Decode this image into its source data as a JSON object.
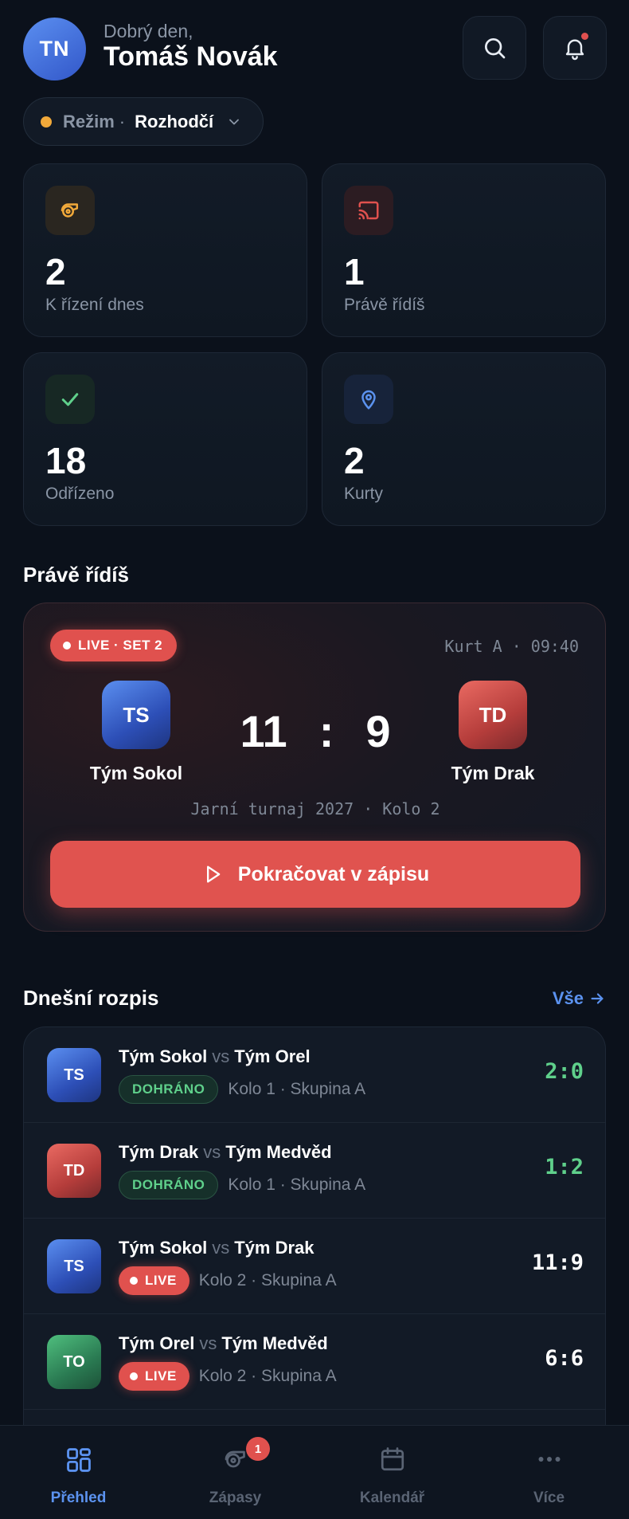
{
  "header": {
    "avatar_initials": "TN",
    "greeting": "Dobrý den,",
    "user_name": "Tomáš Novák",
    "search_icon": "search-icon",
    "bell_icon": "bell-icon"
  },
  "mode": {
    "label": "Režim",
    "separator": "·",
    "value": "Rozhodčí",
    "dot_color": "#f1a93a"
  },
  "stats": [
    {
      "value": "2",
      "label": "K řízení dnes",
      "icon": "whistle-icon",
      "color": "#f1a93a"
    },
    {
      "value": "1",
      "label": "Právě řídíš",
      "icon": "cast-icon",
      "color": "#e0514e"
    },
    {
      "value": "18",
      "label": "Odřízeno",
      "icon": "check-icon",
      "color": "#5fd08b"
    },
    {
      "value": "2",
      "label": "Kurty",
      "icon": "map-pin-icon",
      "color": "#5b92ef"
    }
  ],
  "live_section": {
    "title": "Právě řídíš",
    "badge": "LIVE · SET 2",
    "court_time": "Kurt A · 09:40",
    "home": {
      "initials": "TS",
      "name": "Tým Sokol"
    },
    "away": {
      "initials": "TD",
      "name": "Tým Drak"
    },
    "score_home": "11",
    "score_sep": ":",
    "score_away": "9",
    "tournament": "Jarní turnaj 2027 · Kolo 2",
    "continue_label": "Pokračovat v zápisu"
  },
  "schedule": {
    "title": "Dnešní rozpis",
    "see_all": "Vše",
    "vs": "vs",
    "rows": [
      {
        "initials": "TS",
        "home": "Tým Sokol",
        "away": "Tým Orel",
        "status": "DOHRÁNO",
        "info": "Kolo 1 · Skupina A",
        "result": "2:0"
      },
      {
        "initials": "TD",
        "home": "Tým Drak",
        "away": "Tým Medvěd",
        "status": "DOHRÁNO",
        "info": "Kolo 1 · Skupina A",
        "result": "1:2"
      },
      {
        "initials": "TS",
        "home": "Tým Sokol",
        "away": "Tým Drak",
        "status": "LIVE",
        "info": "Kolo 2 · Skupina A",
        "result": "11:9"
      },
      {
        "initials": "TO",
        "home": "Tým Orel",
        "away": "Tým Medvěd",
        "status": "LIVE",
        "info": "Kolo 2 · Skupina A",
        "result": "6:6"
      }
    ]
  },
  "nav": {
    "items": [
      {
        "label": "Přehled",
        "icon": "grid-icon"
      },
      {
        "label": "Zápasy",
        "icon": "whistle-icon",
        "badge": "1"
      },
      {
        "label": "Kalendář",
        "icon": "calendar-icon"
      },
      {
        "label": "Více",
        "icon": "more-icon"
      }
    ]
  },
  "colors": {
    "background": "#0b111b",
    "accent_blue": "#5b92ef",
    "accent_red": "#e0514e",
    "accent_green": "#5fd08b"
  }
}
